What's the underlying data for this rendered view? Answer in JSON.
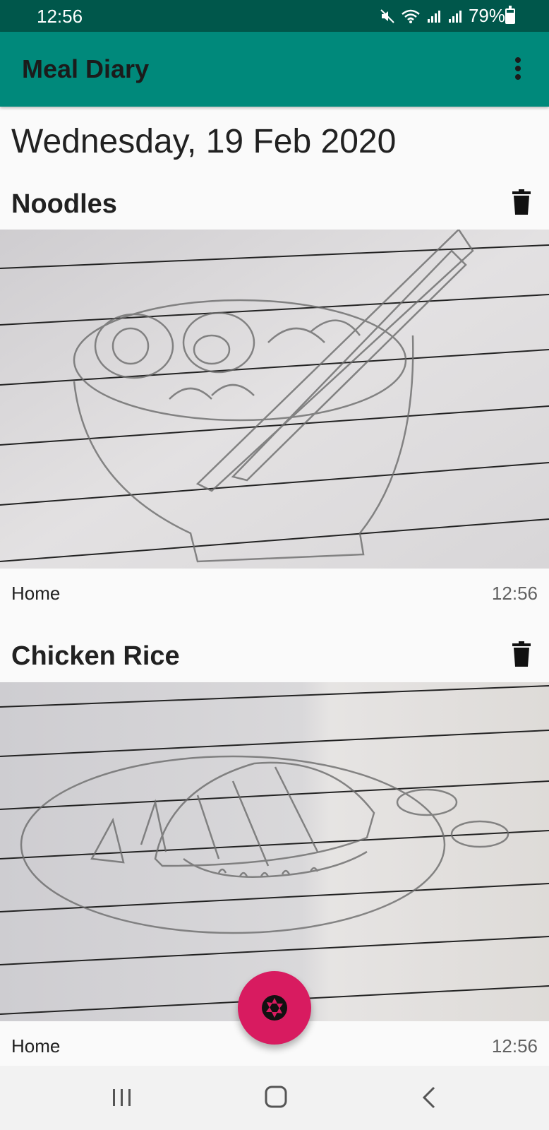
{
  "status_bar": {
    "time": "12:56",
    "battery": "79%",
    "battery_level": 0.79,
    "icons": [
      "mute-icon",
      "wifi-icon",
      "signal-icon",
      "signal-icon"
    ]
  },
  "app_bar": {
    "title": "Meal Diary",
    "menu_icon": "more-vert-icon"
  },
  "date_header": "Wednesday, 19 Feb 2020",
  "meals": [
    {
      "title": "Noodles",
      "location": "Home",
      "time": "12:56",
      "delete_icon": "trash-icon",
      "photo": "noodle-bowl-sketch"
    },
    {
      "title": "Chicken Rice",
      "location": "Home",
      "time": "12:56",
      "delete_icon": "trash-icon",
      "photo": "chicken-rice-plate-sketch"
    }
  ],
  "fab": {
    "icon": "camera-shutter-icon",
    "color": "#d81b60"
  },
  "colors": {
    "status_bar": "#00574b",
    "app_bar": "#00897b",
    "accent": "#d81b60"
  },
  "nav_bar": {
    "icons": [
      "recents-icon",
      "home-icon",
      "back-icon"
    ]
  }
}
